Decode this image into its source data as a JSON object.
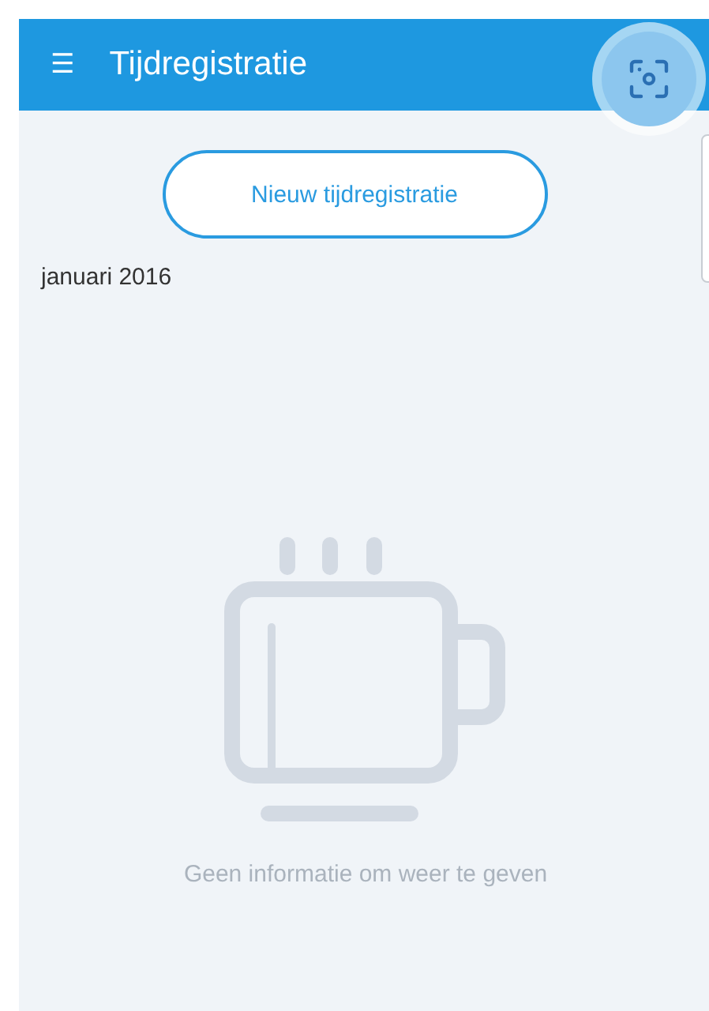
{
  "app_bar": {
    "menu_icon": "☰",
    "title": "Tijdregistratie"
  },
  "new_button": {
    "label": "Nieuw tijdregistratie"
  },
  "month": "januari 2016",
  "empty_state": {
    "message": "Geen informatie om weer te geven"
  }
}
